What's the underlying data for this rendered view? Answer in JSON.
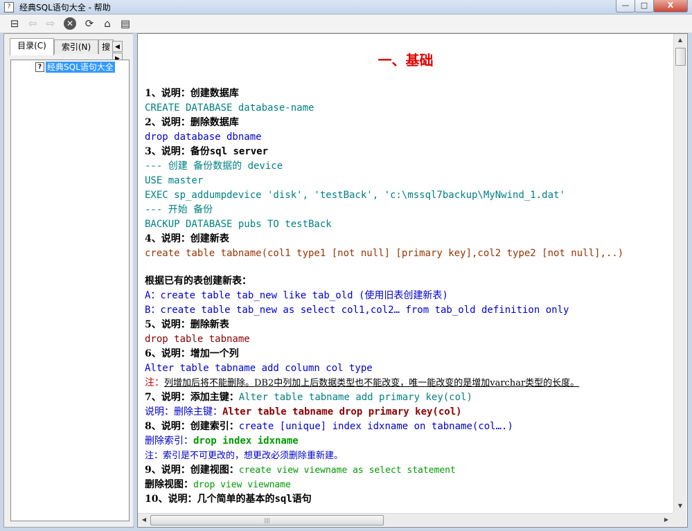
{
  "window": {
    "title": "经典SQL语句大全 - 帮助",
    "title_icon": "?",
    "minimize": "—",
    "maximize": "□",
    "close": "X"
  },
  "toolbar": {
    "hide_icon": "⊟",
    "back_icon": "⇦",
    "forward_icon": "⇨",
    "stop_icon": "✕",
    "refresh_icon": "⟳",
    "home_icon": "⌂",
    "options_icon": "▤"
  },
  "sidebar": {
    "tabs": [
      {
        "label": "目录(C)"
      },
      {
        "label": "索引(N)"
      },
      {
        "label": "搜"
      }
    ],
    "tab_left_arrow": "◀",
    "tab_right_arrow": "▶",
    "tree": {
      "icon": "?",
      "label": "经典SQL语句大全"
    }
  },
  "document": {
    "heading": "一、基础",
    "l1": "1、说明：创建数据库",
    "l2": "CREATE DATABASE database-name",
    "l3": "2、说明：删除数据库",
    "l4": "drop database dbname",
    "l5a": "3、说明：备份",
    "l5b": "sql server",
    "l6": "--- 创建 备份数据的 device",
    "l7": "USE master",
    "l8": "EXEC sp_addumpdevice 'disk', 'testBack', 'c:\\mssql7backup\\MyNwind_1.dat'",
    "l9": "--- 开始 备份",
    "l10": "BACKUP DATABASE pubs TO testBack",
    "l11": "4、说明：创建新表",
    "l12": "create table tabname(col1 type1 [not null] [primary key],col2 type2 [not null],..)",
    "l13": "根据已有的表创建新表：",
    "l14": "A：create table tab_new like tab_old (使用旧表创建新表)",
    "l15": "B：create table tab_new as select col1,col2… from tab_old definition only",
    "l16": "5、说明：删除新表",
    "l17": "drop table tabname",
    "l18": "6、说明：增加一个列",
    "l19": "Alter table tabname add column col type",
    "l20a": "注：",
    "l20b": "列增加后将不能删除。DB2中列加上后数据类型也不能改变，唯一能改变的是增加varchar类型的长度。",
    "l21a": "7、说明：添加主键：",
    "l21b": "Alter table tabname add primary key(col)",
    "l22a": "说明：删除主键：",
    "l22b": "Alter table tabname drop primary key(col)",
    "l23a": "8、说明：创建索引：",
    "l23b": "create [unique] index idxname on tabname(col….)",
    "l24a": "删除索引：",
    "l24b": "drop index idxname",
    "l25": "注：索引是不可更改的，想更改必须删除重新建。",
    "l26a": "9、说明：创建视图：",
    "l26b": "create view viewname as select statement",
    "l27a": "删除视图：",
    "l27b": "drop view viewname",
    "l28a": "10、说明：几个简单的基本的",
    "l28b": "sql",
    "l28c": "语句"
  },
  "scroll": {
    "up": "▲",
    "down": "▼",
    "left": "◀",
    "right": "▶",
    "grip": "|||"
  }
}
